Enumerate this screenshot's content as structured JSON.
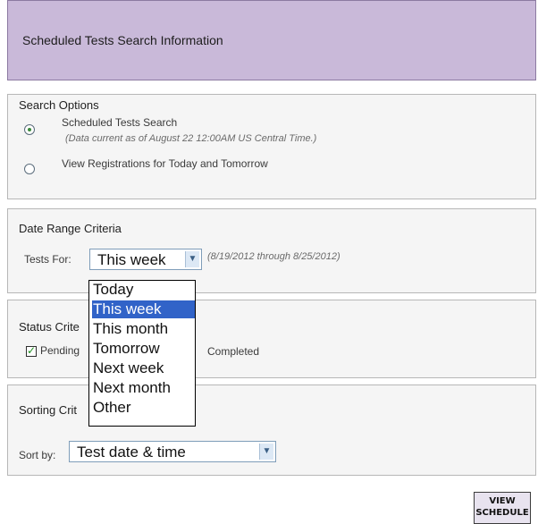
{
  "header": {
    "title": "Scheduled Tests Search Information"
  },
  "search_options": {
    "title": "Search Options",
    "items": [
      {
        "label": "Scheduled Tests Search",
        "note": "(Data current as of August 22 12:00AM US Central Time.)",
        "selected": true
      },
      {
        "label": "View Registrations for Today and Tomorrow",
        "selected": false
      }
    ]
  },
  "date_range": {
    "title": "Date Range Criteria",
    "tests_for_label": "Tests For:",
    "selected_value": "This week",
    "range_note": "(8/19/2012 through 8/25/2012)",
    "options": [
      "Today",
      "This week",
      "This month",
      "Tomorrow",
      "Next week",
      "Next month",
      "Other"
    ]
  },
  "status": {
    "title_visible": "Status Crite",
    "pending_label": "Pending",
    "completed_label": "Completed",
    "pending_checked": true
  },
  "sorting": {
    "title_visible": "Sorting Crit",
    "sort_by_label": "Sort by:",
    "selected_value": "Test date & time"
  },
  "actions": {
    "view_schedule_line1": "VIEW",
    "view_schedule_line2": "SCHEDULE"
  },
  "colors": {
    "header_bg": "#c9b9d9",
    "selected_option_bg": "#3163c8"
  },
  "icons": {
    "dropdown_arrow": "chevron-down-icon",
    "radio_selected": "radio-selected-icon",
    "radio_unselected": "radio-unselected-icon",
    "checkbox_checked": "checkbox-checked-icon"
  }
}
